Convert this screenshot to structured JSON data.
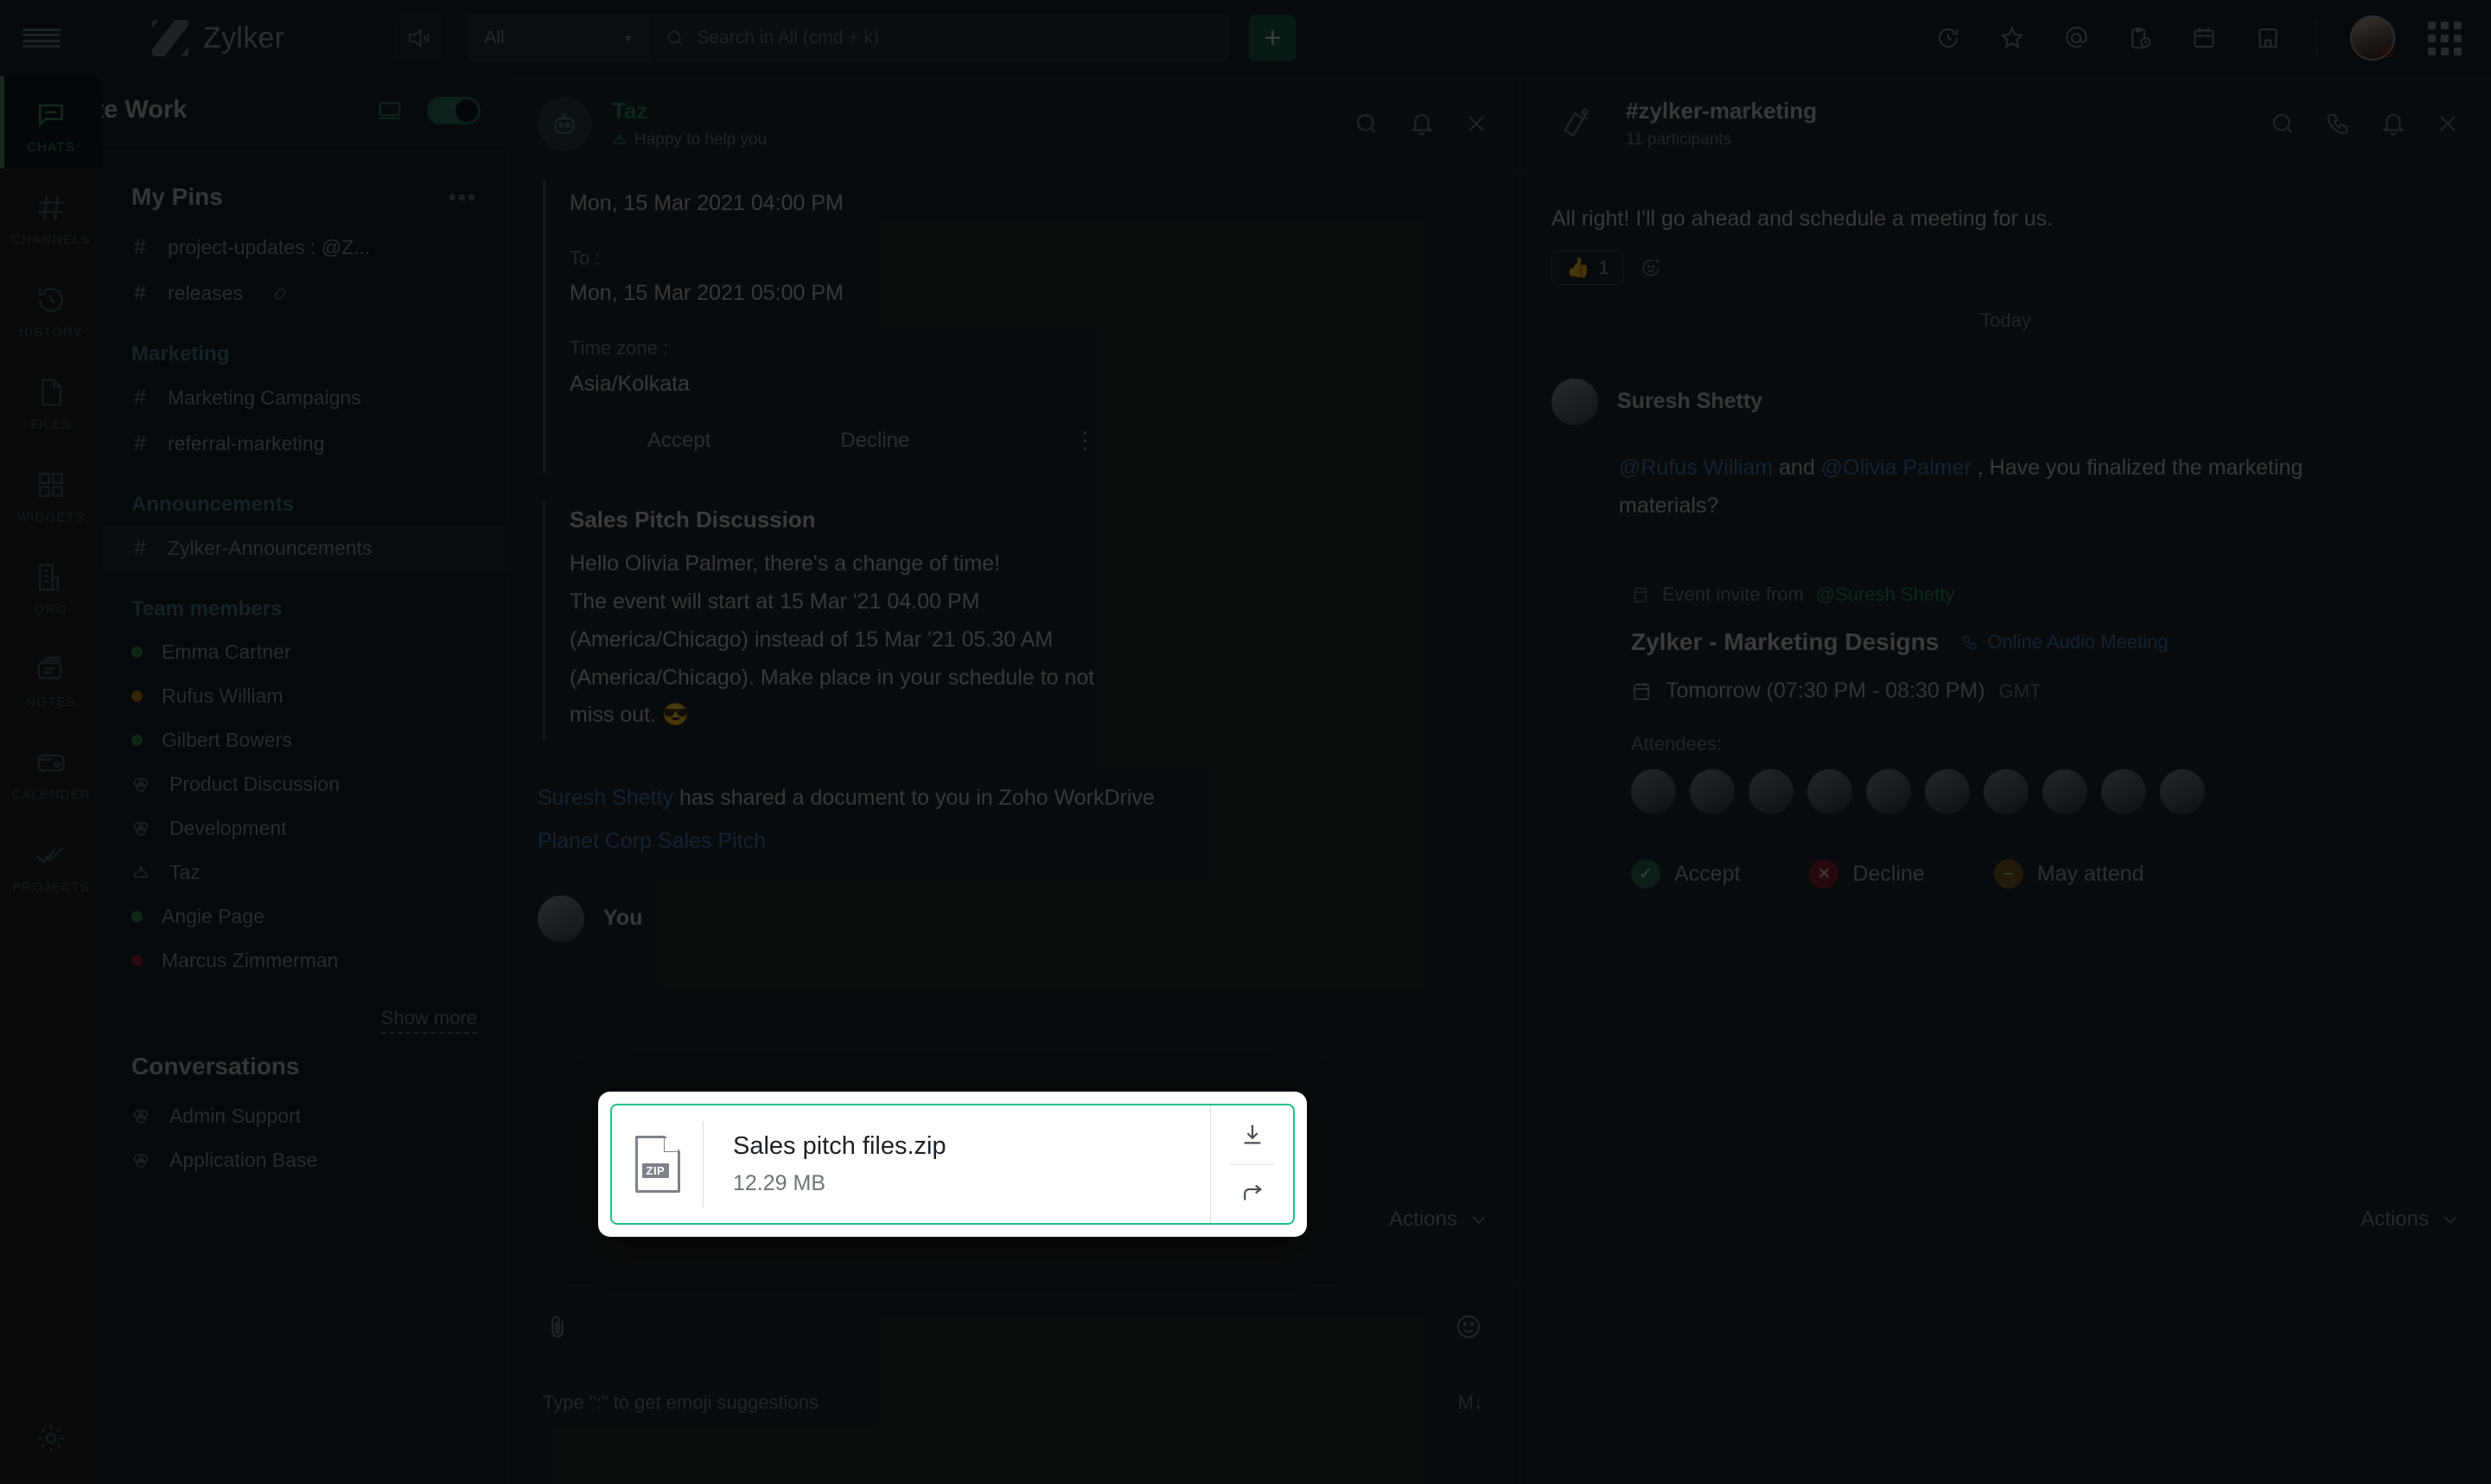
{
  "topbar": {
    "brand": "Zylker",
    "scope_label": "All",
    "search_placeholder": "Search in All (cmd + k)",
    "plus_label": "+",
    "icons": [
      "megaphone-icon",
      "history-icon",
      "star-icon",
      "mentions-icon",
      "tasks-icon",
      "calendar-icon",
      "marketplace-icon",
      "apps-grid-icon"
    ]
  },
  "rail": {
    "items": [
      {
        "label": "CHATS",
        "icon": "chat-bubble-icon",
        "active": true
      },
      {
        "label": "CHANNELS",
        "icon": "hash-icon",
        "active": false
      },
      {
        "label": "HISTORY",
        "icon": "clock-rewind-icon",
        "active": false
      },
      {
        "label": "FILES",
        "icon": "file-icon",
        "active": false
      },
      {
        "label": "WIDGETS",
        "icon": "widgets-grid-icon",
        "active": false
      },
      {
        "label": "ORG",
        "icon": "org-chart-icon",
        "active": false
      },
      {
        "label": "NOTES",
        "icon": "notes-icon",
        "active": false
      },
      {
        "label": "CALENDER",
        "icon": "calendar-wallet-icon",
        "active": false
      },
      {
        "label": "PROJECTS",
        "icon": "double-check-icon",
        "active": false
      }
    ],
    "settings_icon": "gear-icon"
  },
  "sidebar": {
    "workspace_title": "Remote Work",
    "sections": [
      {
        "title": "My Pins",
        "has_menu": true,
        "items": [
          {
            "label": "project-updates : @Z...",
            "icon": "hash-icon",
            "trailing": ""
          },
          {
            "label": "releases",
            "icon": "hash-icon",
            "trailing": "link-icon"
          }
        ]
      },
      {
        "title": "Marketing",
        "sub": true,
        "items": [
          {
            "label": "Marketing Campaigns",
            "icon": "hash-icon"
          },
          {
            "label": "referral-marketing",
            "icon": "hash-icon"
          }
        ]
      },
      {
        "title": "Announcements",
        "sub": true,
        "items": [
          {
            "label": "Zylker-Announcements",
            "icon": "hash-icon",
            "active": true
          }
        ]
      },
      {
        "title": "Team members",
        "sub": true,
        "items": [
          {
            "label": "Emma  Cartner",
            "icon": "status-dot",
            "status": "#2e8b57"
          },
          {
            "label": "Rufus William",
            "icon": "status-dot",
            "status": "#b8860b"
          },
          {
            "label": "Gilbert Bowers",
            "icon": "status-dot",
            "status": "#2e8b57"
          },
          {
            "label": "Product Discussion",
            "icon": "group-icon"
          },
          {
            "label": "Development",
            "icon": "group-icon"
          },
          {
            "label": "Taz",
            "icon": "bot-icon"
          },
          {
            "label": "Angie Page",
            "icon": "status-dot",
            "status": "#2e8b57"
          },
          {
            "label": "Marcus Zimmerman",
            "icon": "status-dot",
            "status": "#a02334"
          }
        ]
      },
      {
        "title": "Conversations",
        "items": [
          {
            "label": "Admin Support",
            "icon": "group-icon"
          },
          {
            "label": "Application Base",
            "icon": "group-icon"
          }
        ]
      }
    ],
    "show_more": "Show more"
  },
  "center_panel": {
    "title": "Taz",
    "subtitle": "Happy to help you",
    "header_icons": [
      "search-icon",
      "bell-icon",
      "close-icon"
    ],
    "schedule": {
      "from_value": "Mon, 15 Mar 2021 04:00 PM",
      "to_label": "To :",
      "to_value": "Mon, 15 Mar 2021 05:00 PM",
      "timezone_label": "Time zone :",
      "timezone_value": "Asia/Kolkata",
      "accept": "Accept",
      "decline": "Decline",
      "more": "⋮"
    },
    "message": {
      "title": "Sales Pitch Discussion",
      "l1": "Hello Olivia Palmer, there's a change of time!",
      "l2a": "The event will start at ",
      "l2b": "15 Mar '21 04.00 PM",
      "l3a": "(America/Chicago)",
      "l3b": " instead of 15 Mar '21 05.30 AM",
      "l4": "(America/Chicago). Make place in your schedule to not",
      "l5": "miss out. 😎"
    },
    "share_notice": {
      "who": "Suresh Shetty",
      "text": " has shared a document to you in Zoho WorkDrive",
      "doc": "Planet Corp Sales Pitch"
    },
    "you_label": "You",
    "actions_label": "Actions",
    "composer_placeholder": "Type \":\" to get emoji suggestions",
    "composer_md": "M↓"
  },
  "right_panel": {
    "title": "#zylker-marketing",
    "participants": "11 participants",
    "header_icons": [
      "search-icon",
      "call-icon",
      "bell-icon",
      "close-icon"
    ],
    "first_message": "All right! I'll go ahead and schedule a meeting for us.",
    "reaction_count": "1",
    "day_divider": "Today",
    "sender": "Suresh Shetty",
    "mention_1": "@Rufus William",
    "mention_join": " and ",
    "mention_2": "@Olivia Palmer",
    "message_tail": " , Have you finalized the marketing materials?",
    "invite_from_label": "Event invite from ",
    "invite_from_name": "@Suresh Shetty",
    "event_title": "Zylker - Marketing Designs",
    "event_type": "Online Audio Meeting",
    "event_when": "Tomorrow (07:30 PM - 08:30 PM)",
    "event_tz": "GMT",
    "attendees_label": "Attendees:",
    "attendee_count": 10,
    "rsvp": {
      "accept": "Accept",
      "decline": "Decline",
      "may": "May attend"
    },
    "actions_label": "Actions"
  },
  "modal": {
    "file_name": "Sales pitch files.zip",
    "file_size": "12.29 MB",
    "file_type_badge": "ZIP",
    "download_icon": "download-icon",
    "forward_icon": "forward-arrow-icon"
  },
  "colors": {
    "accent_green": "#1fc08a",
    "teal": "#2f8f6d",
    "panel_bg": "#1e2a30",
    "sidebar_bg": "#15222a",
    "topbar_bg": "#17252b"
  }
}
